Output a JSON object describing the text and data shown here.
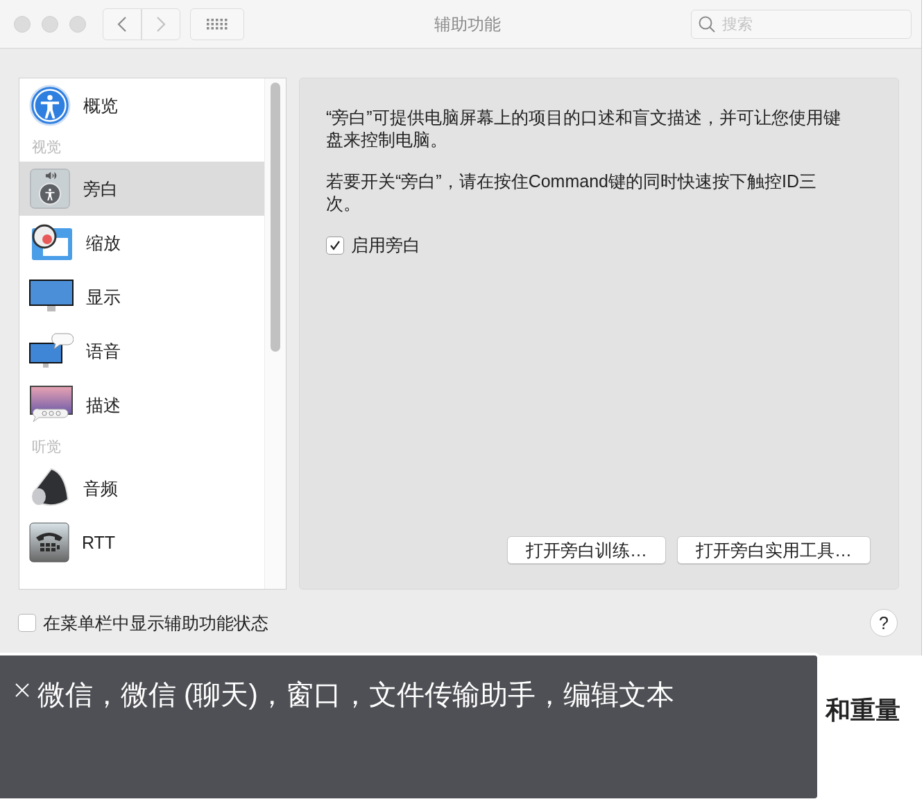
{
  "window": {
    "title": "辅助功能"
  },
  "search": {
    "placeholder": "搜索"
  },
  "sidebar": {
    "items": [
      {
        "kind": "item",
        "label": "概览",
        "selected": false
      },
      {
        "kind": "section",
        "label": "视觉"
      },
      {
        "kind": "item",
        "label": "旁白",
        "selected": true
      },
      {
        "kind": "item",
        "label": "缩放",
        "selected": false
      },
      {
        "kind": "item",
        "label": "显示",
        "selected": false
      },
      {
        "kind": "item",
        "label": "语音",
        "selected": false
      },
      {
        "kind": "item",
        "label": "描述",
        "selected": false
      },
      {
        "kind": "section",
        "label": "听觉"
      },
      {
        "kind": "item",
        "label": "音频",
        "selected": false
      },
      {
        "kind": "item",
        "label": "RTT",
        "selected": false
      }
    ]
  },
  "panel": {
    "paragraphs": [
      "“旁白”可提供电脑屏幕上的项目的口述和盲文描述，并可让您使用键盘来控制电脑。",
      "若要开关“旁白”，请在按住Command键的同时快速按下触控ID三次。"
    ],
    "checkbox": {
      "label": "启用旁白",
      "checked": true
    },
    "buttons": [
      "打开旁白训练…",
      "打开旁白实用工具…"
    ]
  },
  "footer": {
    "checkbox": {
      "label": "在菜单栏中显示辅助功能状态",
      "checked": false
    },
    "help": "?"
  },
  "caption": {
    "text": "微信，微信 (聊天)，窗口，文件传输助手，编辑文本"
  },
  "background": {
    "text": "和重量"
  }
}
